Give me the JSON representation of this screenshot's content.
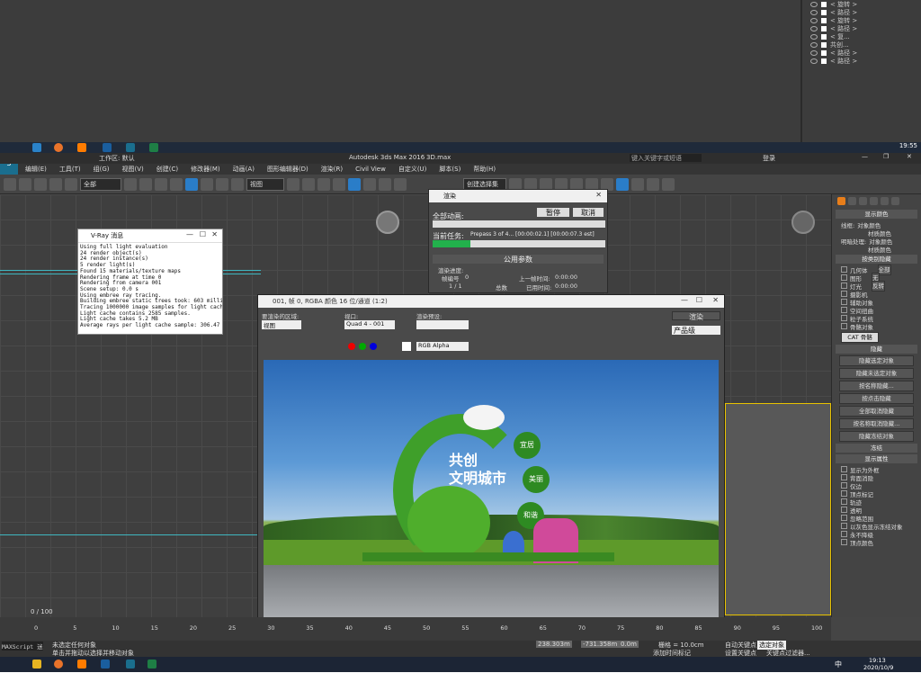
{
  "scene_list": [
    "< 旋转 >",
    "< 路径 >",
    "< 旋转 >",
    "< 路径 >",
    "< 复...",
    "共创...",
    "< 路径 >",
    "< 路径 >"
  ],
  "taskbar_top": {
    "time": "19:55"
  },
  "title": {
    "app": "Autodesk 3ds Max 2016",
    "file": "3D.max",
    "workspace": "工作区: 默认",
    "search": "键入关键字或短语",
    "login": "登录"
  },
  "menu": [
    "编辑(E)",
    "工具(T)",
    "组(G)",
    "视图(V)",
    "创建(C)",
    "修改器(M)",
    "动画(A)",
    "图形编辑器(D)",
    "渲染(R)",
    "Civil View",
    "自定义(U)",
    "脚本(S)",
    "帮助(H)"
  ],
  "toolbar": {
    "filter": "全部",
    "view": "视图",
    "named_sel": "创建选择集"
  },
  "vray": {
    "title": "V-Ray 消息",
    "log": [
      "Using full light evaluation",
      "24 render object(s)",
      "24 render instance(s)",
      "5 render light(s)",
      "Found 15 materials/texture maps",
      "Rendering frame at time 0",
      "Rendering from camera 001",
      "Scene setup: 0.0 s",
      "Using embree ray tracing.",
      "Building embree static trees took: 603 milliseconds",
      "Tracing 1000000 image samples for light cache in 64 passes",
      "Light cache contains 2585 samples.",
      "Light cache takes 5.2 MB",
      "Average rays per light cache sample: 306.47 (min 1, max 22"
    ]
  },
  "render_progress": {
    "title": "渲染",
    "total_label": "全部动画:",
    "pause": "暂停",
    "cancel": "取消",
    "current_label": "当前任务:",
    "current_text": "Prepass 3 of 4... [00:00:02.1] [00:00:07.3 est]",
    "current_progress": 0.22,
    "params_header": "公用参数",
    "render_progress_label": "渲染进度:",
    "frame_label": "帧编号",
    "frame_value": "0",
    "frame_count": "1 / 1",
    "total_word": "总数",
    "last_frame_label": "上一帧时间:",
    "last_frame_time": "0:00:00",
    "elapsed_label": "已用时间:",
    "elapsed_time": "0:00:00"
  },
  "frame_buffer": {
    "title": "001, 帧 0, RGBA 颜色 16 位/通道 (1:2)",
    "area_label": "要渲染的区域:",
    "area_value": "视图",
    "viewport_label": "视口:",
    "viewport_value": "Quad 4 - 001",
    "preset_label": "渲染预设:",
    "render_btn": "渲染",
    "product_value": "产品级",
    "channel_value": "RGB Alpha"
  },
  "sculpture_text": {
    "line1": "共创",
    "line2": "文明城市",
    "circle1": "宜居",
    "circle2": "美丽",
    "circle3": "和谐"
  },
  "cmd_panel": {
    "display_color": "显示颜色",
    "wire": "线框:",
    "obj_color": "对象颜色",
    "mat_color": "材质颜色",
    "shading": "明暗处理:",
    "hide_by_cat": "按类别隐藏",
    "cats": [
      "几何体",
      "图形",
      "灯光",
      "摄影机",
      "辅助对象",
      "空间扭曲",
      "粒子系统",
      "骨骼对象"
    ],
    "btn_all": "全部",
    "btn_none": "无",
    "btn_invert": "反转",
    "list": [
      "CAT 骨骼",
      "骨骼",
      "IK 链对象",
      "点"
    ],
    "add": "添加",
    "remove": "移除",
    "none": "无",
    "hide": "隐藏",
    "hide_buttons": [
      "隐藏选定对象",
      "隐藏未选定对象",
      "按名称隐藏...",
      "按点击隐藏",
      "全部取消隐藏",
      "按名称取消隐藏...",
      "隐藏冻结对象"
    ],
    "freeze": "冻结",
    "display_props": "显示属性",
    "props": [
      "显示为外框",
      "背面消隐",
      "仅边",
      "顶点标记",
      "轨迹",
      "透明",
      "忽略范围",
      "以灰色显示冻结对象",
      "永不降级",
      "顶点颜色"
    ]
  },
  "timeline": {
    "frame": "0 / 100",
    "ticks": [
      "0",
      "5",
      "10",
      "15",
      "20",
      "25",
      "30",
      "35",
      "40",
      "45",
      "50",
      "55",
      "60",
      "65",
      "70",
      "75",
      "80",
      "85",
      "90",
      "95",
      "100"
    ]
  },
  "status": {
    "maxscript": "MAXScript 迷",
    "selected": "未选定任何对象",
    "prompt": "单击并拖动以选择并移动对象",
    "x": "238.303m",
    "y": "-731.358m",
    "z": "0.0m",
    "grid": "栅格 = 10.0cm",
    "add_time_tag": "添加时间标记",
    "auto_key": "自动关键点",
    "sel_obj": "选定对象",
    "set_key": "设置关键点",
    "key_filter": "关键点过滤器..."
  },
  "taskbar_bottom": {
    "time": "19:13",
    "date": "2020/10/9",
    "lang": "中"
  }
}
